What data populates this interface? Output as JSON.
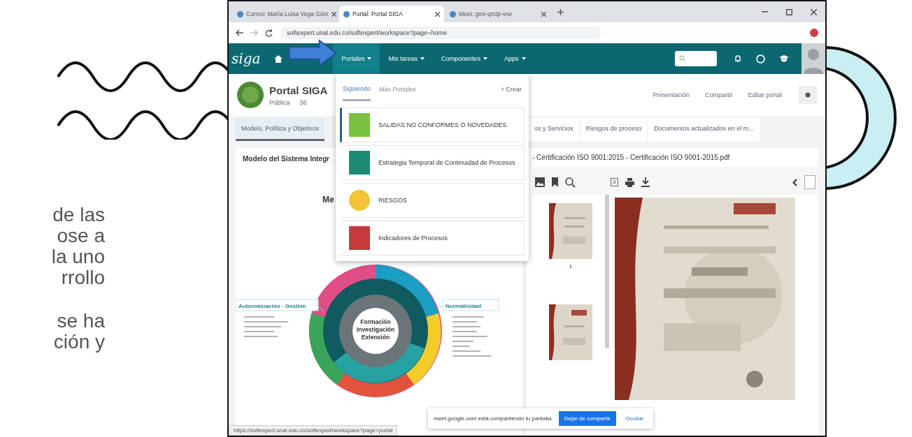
{
  "slide": {
    "text_blocks": [
      {
        "lines": [
          "de las",
          "ose a",
          "la uno",
          "rrollo"
        ]
      },
      {
        "lines": [
          "se ha",
          "ción y"
        ]
      }
    ]
  },
  "browser": {
    "tabs": [
      {
        "title": "Correo: María Luisa Vega Góm",
        "selected": false
      },
      {
        "title": "Portal: Portal SIGA",
        "selected": true
      },
      {
        "title": "Meet: gmr-qmtp-vne",
        "selected": false
      }
    ],
    "url": "softexpert.unal.edu.co/softexpert/workspace?page=home",
    "status_url": "https://softexpert.unal.edu.co/softexpert/workspace?page=portal"
  },
  "nav": {
    "logo": "siga",
    "items": [
      {
        "label": "Portales",
        "selected": true
      },
      {
        "label": "Mis tareas",
        "selected": false
      },
      {
        "label": "Componentes",
        "selected": false
      },
      {
        "label": "Apps",
        "selected": false
      }
    ]
  },
  "portal": {
    "title": "Portal SIGA",
    "visibility": "Pública",
    "followers": "36",
    "actions": [
      "Presentación",
      "Compartir",
      "Editar portal"
    ],
    "tabs": [
      {
        "label": "Modelo, Política y Objetivos",
        "selected": true
      },
      {
        "label": "os y Servicios",
        "selected": false
      },
      {
        "label": "Riesgos de proceso",
        "selected": false
      },
      {
        "label": "Documentos actualizados en el m...",
        "selected": false
      }
    ]
  },
  "left_panel": {
    "title": "Modelo del Sistema Integr",
    "diagram_title": "Me",
    "diagram": {
      "center": [
        "Formación",
        "Investigación",
        "Extensión"
      ],
      "left_box": "Autoevaluación - Gestión",
      "right_box": "Normatividad"
    }
  },
  "right_panel": {
    "title": "- Certificación ISO 9001:2015 - Certificación ISO 9001-2015.pdf",
    "page_label": "1"
  },
  "dropdown": {
    "tabs": [
      {
        "label": "Siguiendo",
        "selected": true
      },
      {
        "label": "Más Portales",
        "selected": false
      }
    ],
    "create": "+ Crear",
    "items": [
      {
        "label": "SALIDAS NO CONFORMES O NOVEDADES",
        "color": "#7cc242",
        "kind": "square",
        "selected": true
      },
      {
        "label": "Estrategia Temporal de Continuidad de Procesos",
        "color": "#1e8a74",
        "kind": "square",
        "selected": false
      },
      {
        "label": "RIESGOS",
        "color": "#f2c335",
        "kind": "round",
        "selected": false
      },
      {
        "label": "Indicadores de Procesos",
        "color": "#c8393b",
        "kind": "square",
        "selected": false
      }
    ]
  },
  "share_bar": {
    "message": "meet.google.com está compartiendo tu pantalla.",
    "stop": "Dejar de compartir",
    "hide": "Ocultar"
  }
}
